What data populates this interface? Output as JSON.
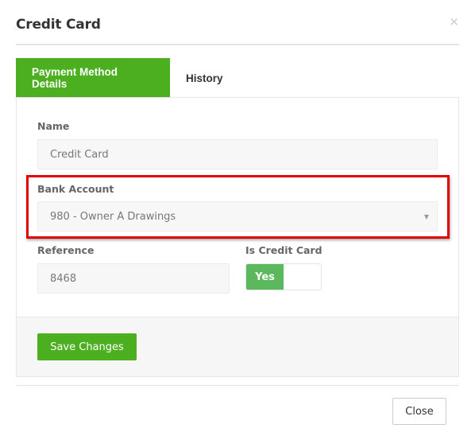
{
  "modal": {
    "title": "Credit Card",
    "close_icon": "×"
  },
  "tabs": [
    {
      "label": "Payment Method Details",
      "active": true
    },
    {
      "label": "History",
      "active": false
    }
  ],
  "form": {
    "name": {
      "label": "Name",
      "value": "Credit Card"
    },
    "bank_account": {
      "label": "Bank Account",
      "value": "980 - Owner A Drawings",
      "arrow": "▼"
    },
    "reference": {
      "label": "Reference",
      "value": "8468"
    },
    "is_credit_card": {
      "label": "Is Credit Card",
      "value": "Yes",
      "checked": true
    }
  },
  "buttons": {
    "save": "Save Changes",
    "close": "Close"
  },
  "colors": {
    "accent_green": "#4caf1f",
    "toggle_green": "#5cb85c",
    "highlight_red": "#e00000"
  }
}
